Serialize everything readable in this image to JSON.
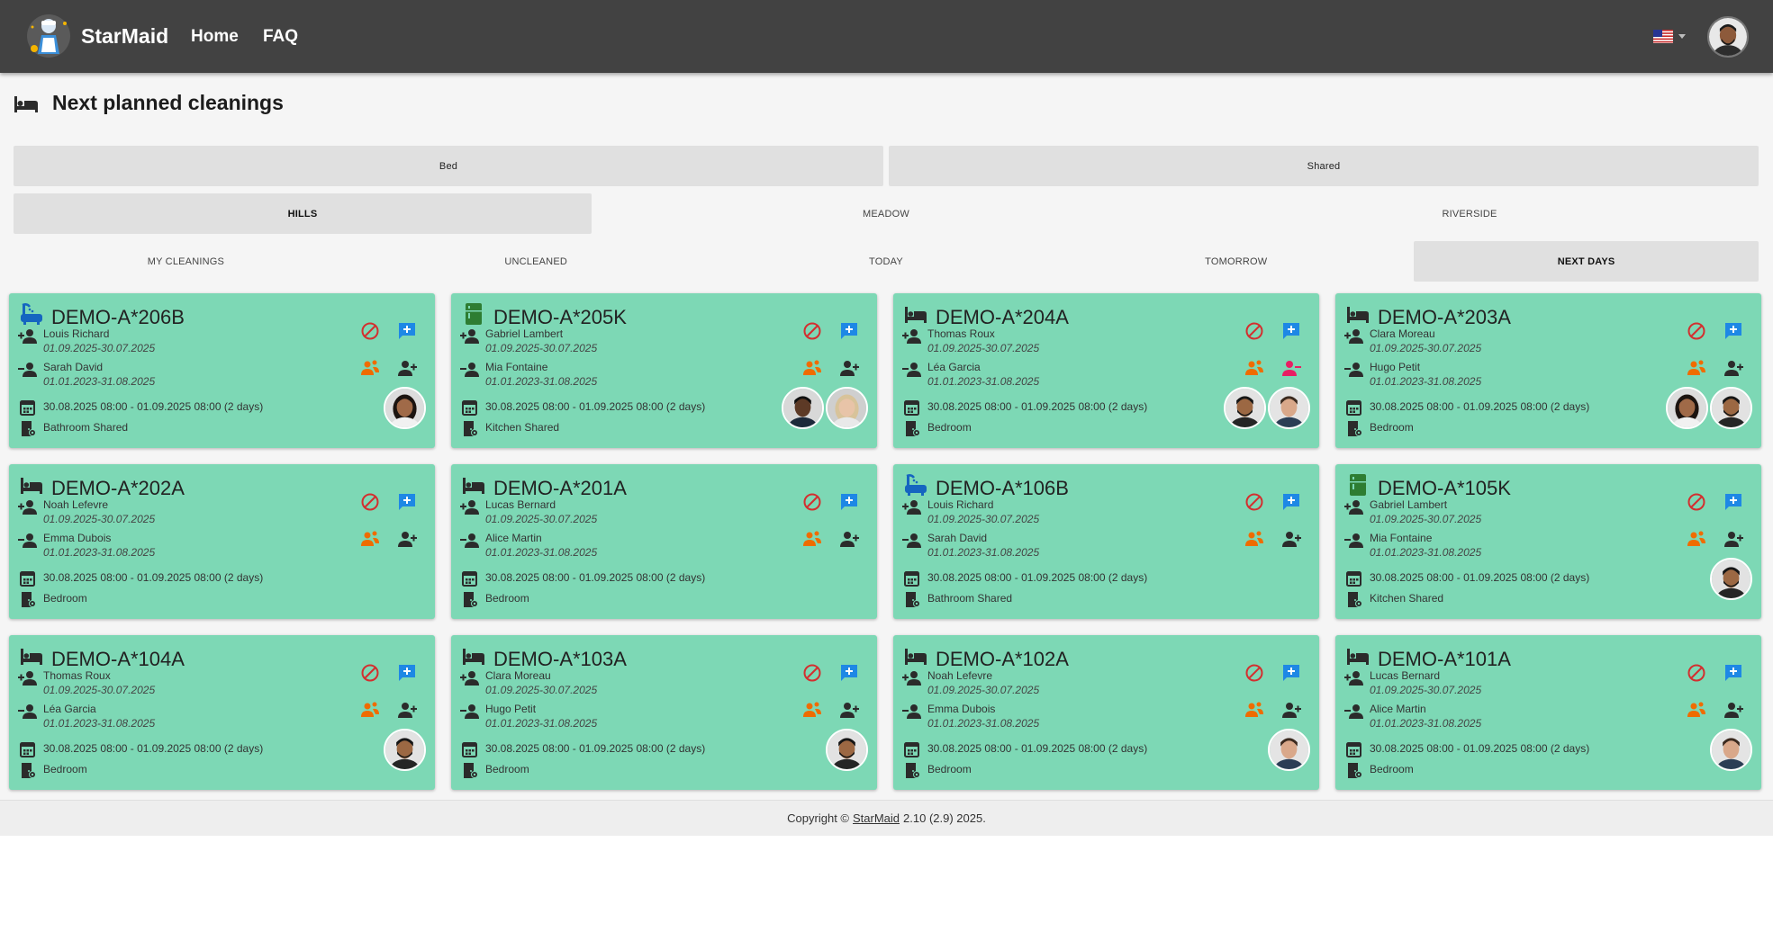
{
  "navbar": {
    "brand": "StarMaid",
    "links": [
      "Home",
      "FAQ"
    ],
    "language": "us-flag-icon"
  },
  "page": {
    "title": "Next planned cleanings",
    "icon": "bed-icon"
  },
  "type_tabs": [
    {
      "label": "Bed",
      "active": false
    },
    {
      "label": "Shared",
      "active": false
    }
  ],
  "location_tabs": [
    {
      "label": "HILLS",
      "active": true
    },
    {
      "label": "MEADOW",
      "active": false
    },
    {
      "label": "RIVERSIDE",
      "active": false
    }
  ],
  "filter_tabs": [
    {
      "label": "MY CLEANINGS",
      "active": false
    },
    {
      "label": "UNCLEANED",
      "active": false
    },
    {
      "label": "TODAY",
      "active": false
    },
    {
      "label": "TOMORROW",
      "active": false
    },
    {
      "label": "NEXT DAYS",
      "active": true
    }
  ],
  "cards": [
    {
      "id": "DEMO-A*206B",
      "icon": "bathtub-icon",
      "guest_in": "Louis Richard",
      "guest_in_dates": "01.09.2025-30.07.2025",
      "guest_out": "Sarah David",
      "guest_out_dates": "01.01.2023-31.08.2025",
      "period": "30.08.2025 08:00 - 01.09.2025 08:00 (2 days)",
      "room_type": "Bathroom Shared",
      "adduser_red": false,
      "avatars": [
        "woman-1"
      ]
    },
    {
      "id": "DEMO-A*205K",
      "icon": "fridge-icon",
      "guest_in": "Gabriel Lambert",
      "guest_in_dates": "01.09.2025-30.07.2025",
      "guest_out": "Mia Fontaine",
      "guest_out_dates": "01.01.2023-31.08.2025",
      "period": "30.08.2025 08:00 - 01.09.2025 08:00 (2 days)",
      "room_type": "Kitchen Shared",
      "adduser_red": false,
      "avatars": [
        "man-2",
        "woman-2"
      ]
    },
    {
      "id": "DEMO-A*204A",
      "icon": "bed-icon",
      "guest_in": "Thomas Roux",
      "guest_in_dates": "01.09.2025-30.07.2025",
      "guest_out": "Léa Garcia",
      "guest_out_dates": "01.01.2023-31.08.2025",
      "period": "30.08.2025 08:00 - 01.09.2025 08:00 (2 days)",
      "room_type": "Bedroom",
      "adduser_red": true,
      "avatars": [
        "man-1",
        "man-3"
      ]
    },
    {
      "id": "DEMO-A*203A",
      "icon": "bed-icon",
      "guest_in": "Clara Moreau",
      "guest_in_dates": "01.09.2025-30.07.2025",
      "guest_out": "Hugo Petit",
      "guest_out_dates": "01.01.2023-31.08.2025",
      "period": "30.08.2025 08:00 - 01.09.2025 08:00 (2 days)",
      "room_type": "Bedroom",
      "adduser_red": false,
      "avatars": [
        "woman-1",
        "man-1"
      ]
    },
    {
      "id": "DEMO-A*202A",
      "icon": "bed-icon",
      "guest_in": "Noah Lefevre",
      "guest_in_dates": "01.09.2025-30.07.2025",
      "guest_out": "Emma Dubois",
      "guest_out_dates": "01.01.2023-31.08.2025",
      "period": "30.08.2025 08:00 - 01.09.2025 08:00 (2 days)",
      "room_type": "Bedroom",
      "adduser_red": false,
      "avatars": []
    },
    {
      "id": "DEMO-A*201A",
      "icon": "bed-icon",
      "guest_in": "Lucas Bernard",
      "guest_in_dates": "01.09.2025-30.07.2025",
      "guest_out": "Alice Martin",
      "guest_out_dates": "01.01.2023-31.08.2025",
      "period": "30.08.2025 08:00 - 01.09.2025 08:00 (2 days)",
      "room_type": "Bedroom",
      "adduser_red": false,
      "avatars": []
    },
    {
      "id": "DEMO-A*106B",
      "icon": "bathtub-icon",
      "guest_in": "Louis Richard",
      "guest_in_dates": "01.09.2025-30.07.2025",
      "guest_out": "Sarah David",
      "guest_out_dates": "01.01.2023-31.08.2025",
      "period": "30.08.2025 08:00 - 01.09.2025 08:00 (2 days)",
      "room_type": "Bathroom Shared",
      "adduser_red": false,
      "avatars": []
    },
    {
      "id": "DEMO-A*105K",
      "icon": "fridge-icon",
      "guest_in": "Gabriel Lambert",
      "guest_in_dates": "01.09.2025-30.07.2025",
      "guest_out": "Mia Fontaine",
      "guest_out_dates": "01.01.2023-31.08.2025",
      "period": "30.08.2025 08:00 - 01.09.2025 08:00 (2 days)",
      "room_type": "Kitchen Shared",
      "adduser_red": false,
      "avatars": [
        "man-1"
      ]
    },
    {
      "id": "DEMO-A*104A",
      "icon": "bed-icon",
      "guest_in": "Thomas Roux",
      "guest_in_dates": "01.09.2025-30.07.2025",
      "guest_out": "Léa Garcia",
      "guest_out_dates": "01.01.2023-31.08.2025",
      "period": "30.08.2025 08:00 - 01.09.2025 08:00 (2 days)",
      "room_type": "Bedroom",
      "adduser_red": false,
      "avatars": [
        "man-1"
      ]
    },
    {
      "id": "DEMO-A*103A",
      "icon": "bed-icon",
      "guest_in": "Clara Moreau",
      "guest_in_dates": "01.09.2025-30.07.2025",
      "guest_out": "Hugo Petit",
      "guest_out_dates": "01.01.2023-31.08.2025",
      "period": "30.08.2025 08:00 - 01.09.2025 08:00 (2 days)",
      "room_type": "Bedroom",
      "adduser_red": false,
      "avatars": [
        "man-1"
      ]
    },
    {
      "id": "DEMO-A*102A",
      "icon": "bed-icon",
      "guest_in": "Noah Lefevre",
      "guest_in_dates": "01.09.2025-30.07.2025",
      "guest_out": "Emma Dubois",
      "guest_out_dates": "01.01.2023-31.08.2025",
      "period": "30.08.2025 08:00 - 01.09.2025 08:00 (2 days)",
      "room_type": "Bedroom",
      "adduser_red": false,
      "avatars": [
        "man-3"
      ]
    },
    {
      "id": "DEMO-A*101A",
      "icon": "bed-icon",
      "guest_in": "Lucas Bernard",
      "guest_in_dates": "01.09.2025-30.07.2025",
      "guest_out": "Alice Martin",
      "guest_out_dates": "01.01.2023-31.08.2025",
      "period": "30.08.2025 08:00 - 01.09.2025 08:00 (2 days)",
      "room_type": "Bedroom",
      "adduser_red": false,
      "avatars": [
        "man-3"
      ]
    }
  ],
  "footer": {
    "prefix": "Copyright ©",
    "link": "StarMaid",
    "suffix": "2.10 (2.9) 2025."
  },
  "colors": {
    "navbar": "#424242",
    "card": "#7dd8b5",
    "ban": "#d32f2f",
    "chat": "#1e88e5",
    "swap": "#ef6c00",
    "remove_user": "#e91e63",
    "icon_dark": "#2b2b2b",
    "bath": "#1565c0",
    "fridge": "#2e7d32"
  }
}
